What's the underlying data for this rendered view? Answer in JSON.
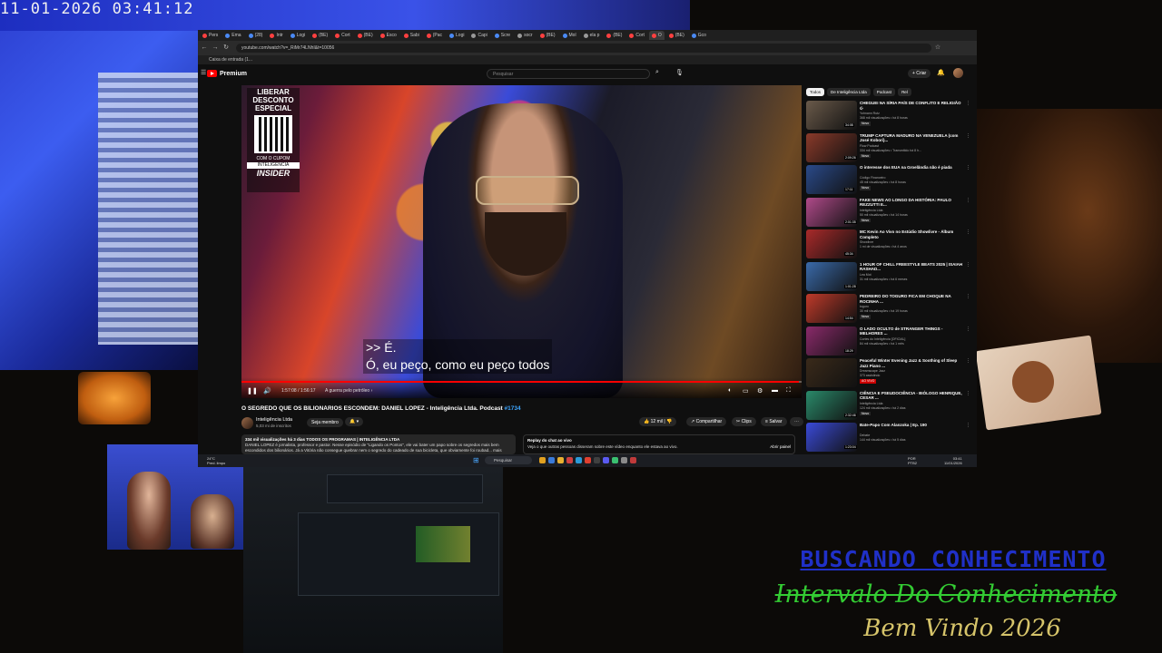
{
  "overlay": {
    "timestamp": "11-01-2026 03:41:12",
    "title_1": "BUSCANDO CONHECIMENTO",
    "title_2": "Intervalo Do Conhecimento",
    "title_3": "Bem Vindo 2026"
  },
  "browser": {
    "tabs": [
      {
        "label": "Pers",
        "color": "#ff4040"
      },
      {
        "label": "Ema",
        "color": "#4a8af4"
      },
      {
        "label": "(28)",
        "color": "#4a8af4"
      },
      {
        "label": "Intr",
        "color": "#ff4040"
      },
      {
        "label": "Logi",
        "color": "#4a8af4"
      },
      {
        "label": "(BE)",
        "color": "#ff4040"
      },
      {
        "label": "Cort",
        "color": "#ff4040"
      },
      {
        "label": "(BE)",
        "color": "#ff4040"
      },
      {
        "label": "Esco",
        "color": "#ff4040"
      },
      {
        "label": "Sabi",
        "color": "#ff4040"
      },
      {
        "label": "(Pac",
        "color": "#ff4040"
      },
      {
        "label": "Logi",
        "color": "#4a8af4"
      },
      {
        "label": "Capi",
        "color": "#999999"
      },
      {
        "label": "Scre",
        "color": "#4a8af4"
      },
      {
        "label": "socr",
        "color": "#999999"
      },
      {
        "label": "(BE)",
        "color": "#ff4040"
      },
      {
        "label": "Mol",
        "color": "#4a8af4"
      },
      {
        "label": "ela p",
        "color": "#999999"
      },
      {
        "label": "(BE)",
        "color": "#ff4040"
      },
      {
        "label": "Cort",
        "color": "#ff4040"
      },
      {
        "label": "O",
        "color": "#ff4040",
        "active": true
      },
      {
        "label": "(BE)",
        "color": "#ff4040"
      },
      {
        "label": "Gco",
        "color": "#4a8af4"
      }
    ],
    "url": "youtube.com/watch?v=_RiMr74LNhI&t=10056",
    "bookmark": "Caixa de entrada (1..."
  },
  "youtube": {
    "logo_text": "Premium",
    "search_placeholder": "Pesquisar",
    "create_label": "+ Criar",
    "video": {
      "promo_top": "LIBERAR DESCONTO ESPECIAL",
      "promo_cupom": "COM O CUPOM",
      "promo_code": "INTELIGENCIA",
      "promo_brand": "INSIDER",
      "subtitle_line_1": ">> É.",
      "subtitle_line_2": "Ó, eu peço, como eu peço todos",
      "time": "1:57:08 / 1:56:17",
      "chapter": "A guerra pelo petróleo  ›",
      "progress": 0.995
    },
    "title": "O SEGREDO QUE OS BILIONÁRIOS ESCONDEM: DANIEL LOPEZ - Inteligência Ltda. Podcast",
    "title_tag": "#1734",
    "channel_name": "Inteligência Ltda",
    "channel_subs": "5,03 mi de inscritos",
    "join_label": "Seja membro",
    "likes": "12 mil",
    "share_label": "Compartilhar",
    "clips_label": "Clips",
    "save_label": "Salvar",
    "desc_meta": "334 mil visualizações  há 3 dias  TODOS OS PROGRAMAS | INTELIGÊNCIA LTDA",
    "desc_text": "DANIEL LOPEZ é jornalista, professor e pastor. Nesse episódio de \"Ligando os Pontos\", ele vai bater um papo sobre os segredos mais bem escondidos dos bilionários. Já a Vitória não consegue quebrar nem o segredo do cadeado de sua bicicleta, que obviamente foi roubad... mais",
    "chat_title": "Replay do chat ao vivo",
    "chat_text": "Veja o que outras pessoas disseram sobre este vídeo enquanto ele estava ao vivo.",
    "chat_open": "Abrir painel",
    "chips": [
      "Todos",
      "De Inteligência Ltda",
      "Podcast",
      "Rel"
    ],
    "recommendations": [
      {
        "title": "CHEGUEI NA SÍRIA PAÍS DE CONFLITO E RELIGIÃO ☪",
        "channel": "Yohnann Rutz",
        "meta": "368 mil visualizações • há 8 horas",
        "badge": "Novo",
        "duration": "34:08",
        "color": "#6a5a4a"
      },
      {
        "title": "TRUMP CAPTURA MADURO NA VENEZUELA (com José Kobori)...",
        "channel": "Flow Podcast",
        "meta": "334 mil visualizações • Transmitido há 8 h...",
        "badge": "Novo",
        "duration": "2:09:26",
        "color": "#8a3a2a"
      },
      {
        "title": "O interesse dos EUA na Groelândia não é piada",
        "channel": "Código Financeiro",
        "meta": "45 mil visualizações • há 8 horas",
        "badge": "Novo",
        "duration": "17:11",
        "color": "#2a4a8a"
      },
      {
        "title": "FAKE NEWS AO LONGO DA HISTÓRIA: PAULO REZZUTTI E...",
        "channel": "Inteligência Ltda",
        "meta": "50 mil visualizações • há 14 horas",
        "badge": "Novo",
        "duration": "2:01:35",
        "color": "#b04a8a"
      },
      {
        "title": "MC Kevin Ao Vivo no Estúdio Showlivre - Álbum Completo",
        "channel": "Showlivre",
        "meta": "1 mi de visualizações • há 4 anos",
        "badge": "",
        "duration": "45:34",
        "color": "#aa2a2a"
      },
      {
        "title": "1 HOUR OF CHILL FREESTYLE BEATS 2025 | ISAIAH RASHAD...",
        "channel": "Lea Mot",
        "meta": "31 mil visualizações • há 6 meses",
        "badge": "",
        "duration": "1:01:28",
        "color": "#3a6aaa"
      },
      {
        "title": "PEDREIRO DO TOGURO FICA EM CHOQUE NA ROCINHA ...",
        "channel": "toguro",
        "meta": "30 mil visualizações • há 19 horas",
        "badge": "Novo",
        "duration": "14:54",
        "color": "#c03a2a"
      },
      {
        "title": "O LADO OCULTO de STRANGER THINGS - MELHORES ...",
        "channel": "Cortes do Inteligência [OFICIAL]",
        "meta": "84 mil visualizações • há 1 mês",
        "badge": "",
        "duration": "18:29",
        "color": "#8a2a6a"
      },
      {
        "title": "Peaceful Winter Evening Jazz & Soothing of Sleep Jazz Piano ...",
        "channel": "Dreamscape Jazz",
        "meta": "373 assistindo",
        "badge": "AO VIVO",
        "duration": "",
        "color": "#3a2a1a"
      },
      {
        "title": "CIÊNCIA E PSEUDOCIÊNCIA - BIÓLOGO HENRIQUE, CESAR ...",
        "channel": "Inteligência Ltda",
        "meta": "124 mil visualizações • há 2 dias",
        "badge": "Novo",
        "duration": "2:32:46",
        "color": "#2a8a6a"
      },
      {
        "title": "Bate-Papo Com Alanzoka | Ep. 190",
        "channel": "Debate",
        "meta": "144 mil visualizações • há 5 dias",
        "badge": "",
        "duration": "1:23:04",
        "color": "#3a4ad8"
      }
    ]
  },
  "taskbar": {
    "weather_temp": "24°C",
    "weather_desc": "Pred. limpo",
    "search_label": "Pesquisar",
    "time": "03:41",
    "date": "11/01/2026",
    "lang_1": "POR",
    "lang_2": "PTB2"
  }
}
